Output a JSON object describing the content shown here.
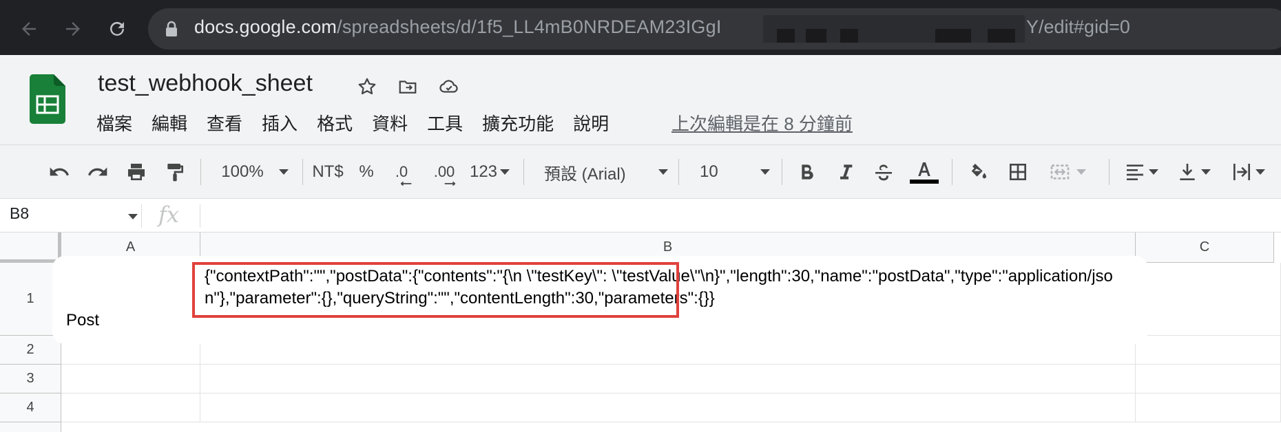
{
  "browser": {
    "url_host": "docs.google.com",
    "url_path": "/spreadsheets/d/1f5_LL4mB0NRDEAM23IGgI",
    "url_tail": "Y/edit#gid=0"
  },
  "app": {
    "title": "test_webhook_sheet",
    "menu": [
      "檔案",
      "編輯",
      "查看",
      "插入",
      "格式",
      "資料",
      "工具",
      "擴充功能",
      "說明"
    ],
    "last_edit": "上次編輯是在 8 分鐘前"
  },
  "toolbar": {
    "zoom": "100%",
    "currency": "NT$",
    "percent": "%",
    "decrease_decimal": ".0",
    "increase_decimal": ".00",
    "more_formats": "123",
    "font": "預設 (Arial)",
    "font_size": "10",
    "text_color": "#000000"
  },
  "formula_bar": {
    "cell_ref": "B8",
    "fx": "fx",
    "value": ""
  },
  "grid": {
    "columns": [
      "A",
      "B",
      "C"
    ],
    "rows": [
      "1",
      "2",
      "3",
      "4"
    ],
    "a1": "Post",
    "b1": "{\"contextPath\":\"\",\"postData\":{\"contents\":\"{\\n    \\\"testKey\\\": \\\"testValue\\\"\\n}\",\"length\":30,\"name\":\"postData\",\"type\":\"application/json\"},\"parameter\":{},\"queryString\":\"\",\"contentLength\":30,\"parameters\":{}}"
  },
  "colors": {
    "highlight_border": "#e0413c",
    "sheets_green": "#188038"
  }
}
